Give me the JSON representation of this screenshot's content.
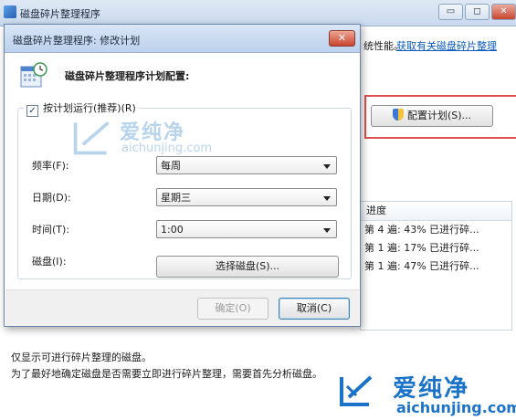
{
  "back_window": {
    "title": "磁盘碎片整理程序",
    "controls": [
      "▭",
      "◻",
      "✕"
    ],
    "description_tail": "统性能。",
    "help_link": "获取有关磁盘碎片整理",
    "configure_button": "配置计划(S)...",
    "list_header": "进度",
    "list_rows": [
      "第 4 遍: 43% 已进行碎...",
      "第 1 遍: 17% 已进行碎...",
      "第 1 遍: 47% 已进行碎..."
    ],
    "footer_line1": "仅显示可进行碎片整理的磁盘。",
    "footer_line2": "为了最好地确定磁盘是否需要立即进行碎片整理，需要首先分析磁盘。"
  },
  "dialog": {
    "title": "磁盘碎片整理程序: 修改计划",
    "close_label": "✕",
    "heading": "磁盘碎片整理程序计划配置:",
    "run_on_schedule": {
      "label": "按计划运行(推荐)(R)",
      "checked": true
    },
    "frequency": {
      "label": "频率(F):",
      "value": "每周"
    },
    "day": {
      "label": "日期(D):",
      "value": "星期三"
    },
    "time": {
      "label": "时间(T):",
      "value": "1:00"
    },
    "disks": {
      "label": "磁盘(I):",
      "button": "选择磁盘(S)..."
    },
    "ok_label": "确定(O)",
    "cancel_label": "取消(C)"
  },
  "watermark": {
    "brand_cn": "爱纯净",
    "brand_url": "aichunjing.com"
  }
}
